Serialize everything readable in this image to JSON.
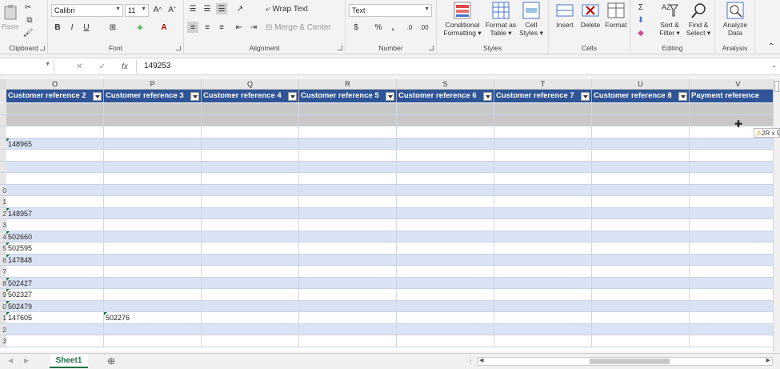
{
  "ribbon": {
    "clipboard": {
      "label": "Clipboard",
      "paste": "Paste"
    },
    "font": {
      "label": "Font",
      "font_name": "Calibri",
      "font_size": "11"
    },
    "alignment": {
      "label": "Alignment",
      "wrap_text": "Wrap Text",
      "merge_center": "Merge & Center"
    },
    "number": {
      "label": "Number",
      "format": "Text"
    },
    "styles": {
      "label": "Styles",
      "conditional": "Conditional",
      "formatting": "Formatting ▾",
      "format_as": "Format as",
      "table": "Table ▾",
      "cell": "Cell",
      "cell_styles": "Styles ▾"
    },
    "cells": {
      "label": "Cells",
      "insert": "Insert",
      "delete": "Delete",
      "format": "Format"
    },
    "editing": {
      "label": "Editing",
      "sort": "Sort &",
      "filter": "Filter ▾",
      "find": "Find &",
      "select": "Select ▾"
    },
    "analysis": {
      "label": "Analysis",
      "analyze": "Analyze",
      "data": "Data"
    }
  },
  "formula_bar": {
    "fx": "fx",
    "value": "149253"
  },
  "columns": [
    {
      "letter": "O",
      "header": "Customer reference 2"
    },
    {
      "letter": "P",
      "header": "Customer reference 3"
    },
    {
      "letter": "Q",
      "header": "Customer reference 4"
    },
    {
      "letter": "R",
      "header": "Customer reference 5"
    },
    {
      "letter": "S",
      "header": "Customer reference 6"
    },
    {
      "letter": "T",
      "header": "Customer reference 7"
    },
    {
      "letter": "U",
      "header": "Customer reference 8"
    },
    {
      "letter": "V",
      "header": "Payment reference"
    }
  ],
  "rows": [
    {
      "num": "",
      "shaded": true,
      "cells": [
        "",
        ""
      ]
    },
    {
      "num": "",
      "shaded": true,
      "cells": [
        "",
        ""
      ]
    },
    {
      "num": "",
      "shaded": false,
      "cells": [
        "",
        ""
      ]
    },
    {
      "num": "",
      "shaded": true,
      "cells": [
        "148965",
        ""
      ]
    },
    {
      "num": "",
      "shaded": false,
      "cells": [
        "",
        ""
      ]
    },
    {
      "num": "",
      "shaded": true,
      "cells": [
        "",
        ""
      ]
    },
    {
      "num": "",
      "shaded": false,
      "cells": [
        "",
        ""
      ]
    },
    {
      "num": "0",
      "shaded": true,
      "cells": [
        "",
        ""
      ]
    },
    {
      "num": "1",
      "shaded": false,
      "cells": [
        "",
        ""
      ]
    },
    {
      "num": "2",
      "shaded": true,
      "cells": [
        "148957",
        ""
      ]
    },
    {
      "num": "3",
      "shaded": false,
      "cells": [
        "",
        ""
      ]
    },
    {
      "num": "4",
      "shaded": true,
      "cells": [
        "502660",
        ""
      ]
    },
    {
      "num": "5",
      "shaded": false,
      "cells": [
        "502595",
        ""
      ]
    },
    {
      "num": "6",
      "shaded": true,
      "cells": [
        "147848",
        ""
      ]
    },
    {
      "num": "7",
      "shaded": false,
      "cells": [
        "",
        ""
      ]
    },
    {
      "num": "8",
      "shaded": true,
      "cells": [
        "502427",
        ""
      ]
    },
    {
      "num": "9",
      "shaded": false,
      "cells": [
        "502327",
        ""
      ]
    },
    {
      "num": "0",
      "shaded": true,
      "cells": [
        "502479",
        ""
      ]
    },
    {
      "num": "1",
      "shaded": false,
      "cells": [
        "147605",
        "502276"
      ]
    },
    {
      "num": "2",
      "shaded": true,
      "cells": [
        "",
        ""
      ]
    },
    {
      "num": "3",
      "shaded": false,
      "cells": [
        "",
        ""
      ]
    }
  ],
  "sheet_tab": "Sheet1",
  "tooltip": "2R x 9",
  "colors": {
    "header_blue": "#2f5597",
    "band_blue": "#dae3f3",
    "excel_green": "#1e7145"
  }
}
